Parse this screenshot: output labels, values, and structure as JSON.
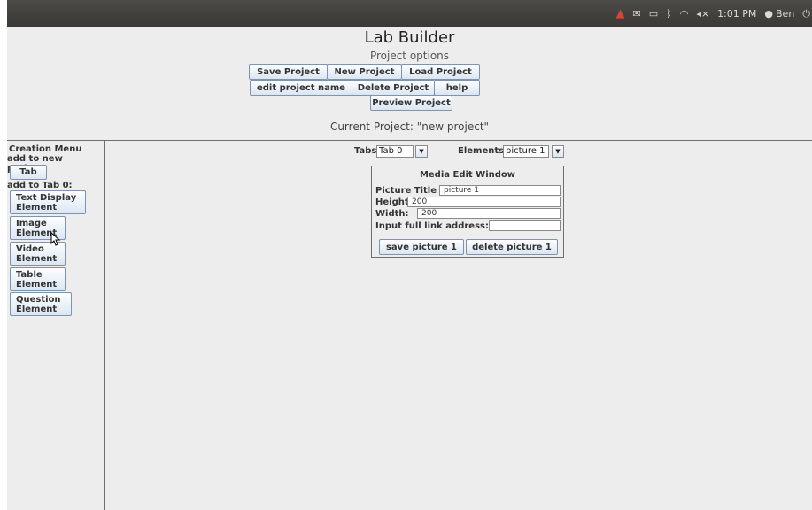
{
  "system_tray": {
    "time": "1:01 PM",
    "user": "Ben",
    "icons": [
      "warning-icon",
      "mail-icon",
      "battery-icon",
      "bluetooth-icon",
      "wifi-icon",
      "volume-icon",
      "user-icon",
      "power-icon"
    ]
  },
  "header": {
    "title": "Lab Builder",
    "subtitle": "Project options",
    "buttons": {
      "save": "Save Project",
      "new": "New Project",
      "load": "Load Project",
      "edit_name": "edit project name",
      "delete": "Delete Project",
      "help": "help",
      "preview": "Preview Project"
    },
    "current_project": "Current Project: \"new project\""
  },
  "sidebar": {
    "title": "Creation Menu",
    "add_new_label": "add to new project:",
    "tab_button": "Tab",
    "add_tab_label": "add to Tab 0:",
    "buttons": [
      {
        "line1": "Text Display",
        "line2": "Element"
      },
      {
        "line1": "Image",
        "line2": "Element"
      },
      {
        "line1": "Video",
        "line2": "Element"
      },
      {
        "line1": "Table",
        "line2": "Element"
      },
      {
        "line1": "Question",
        "line2": "Element"
      }
    ]
  },
  "main": {
    "tabs_label": "Tabs:",
    "tabs_value": "Tab 0",
    "elements_label": "Elements:",
    "elements_value": "picture 1",
    "panel": {
      "title": "Media Edit Window",
      "picture_title_label": "Picture Title",
      "picture_title_value": "picture 1",
      "height_label": "Height:",
      "height_value": "200",
      "width_label": "Width:",
      "width_value": "200",
      "link_label": "Input full link address:",
      "link_value": "",
      "save_button": "save picture 1",
      "delete_button": "delete picture 1"
    }
  },
  "colors": {
    "topbar": "#3f3e3a",
    "background": "#ededed",
    "button_gradient_top": "#fdfeff",
    "button_gradient_bottom": "#dbe6f3",
    "button_border": "#7f93ab",
    "warning": "#d9443a"
  }
}
